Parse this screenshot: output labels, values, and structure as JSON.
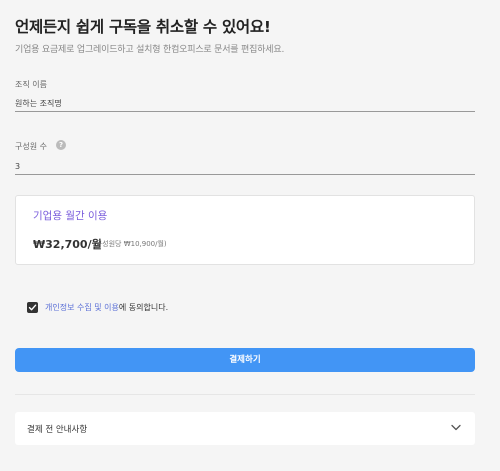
{
  "header": {
    "title": "언제든지 쉽게 구독을 취소할 수 있어요!",
    "subtitle": "기업용 요금제로 업그레이드하고 설치형 한컴오피스로 문서를 편집하세요."
  },
  "form": {
    "org_name_label": "조직 이름",
    "org_name_value": "원하는 조직명",
    "members_label": "구성원 수",
    "members_help_icon": "question-circle-icon",
    "members_value": "3"
  },
  "plan": {
    "name": "기업용 월간 이용",
    "price": "₩32,700/월",
    "per_member": "(구성원당 ₩10,900/월)",
    "accent_color": "#7a5ddc"
  },
  "consent": {
    "checked": true,
    "link_text": "개인정보 수집 및 이용",
    "rest_text": "에 동의합니다."
  },
  "actions": {
    "pay_label": "결제하기",
    "button_color": "#4295f5"
  },
  "accordion": {
    "label": "결제 전 안내사항",
    "icon": "chevron-down-icon"
  }
}
